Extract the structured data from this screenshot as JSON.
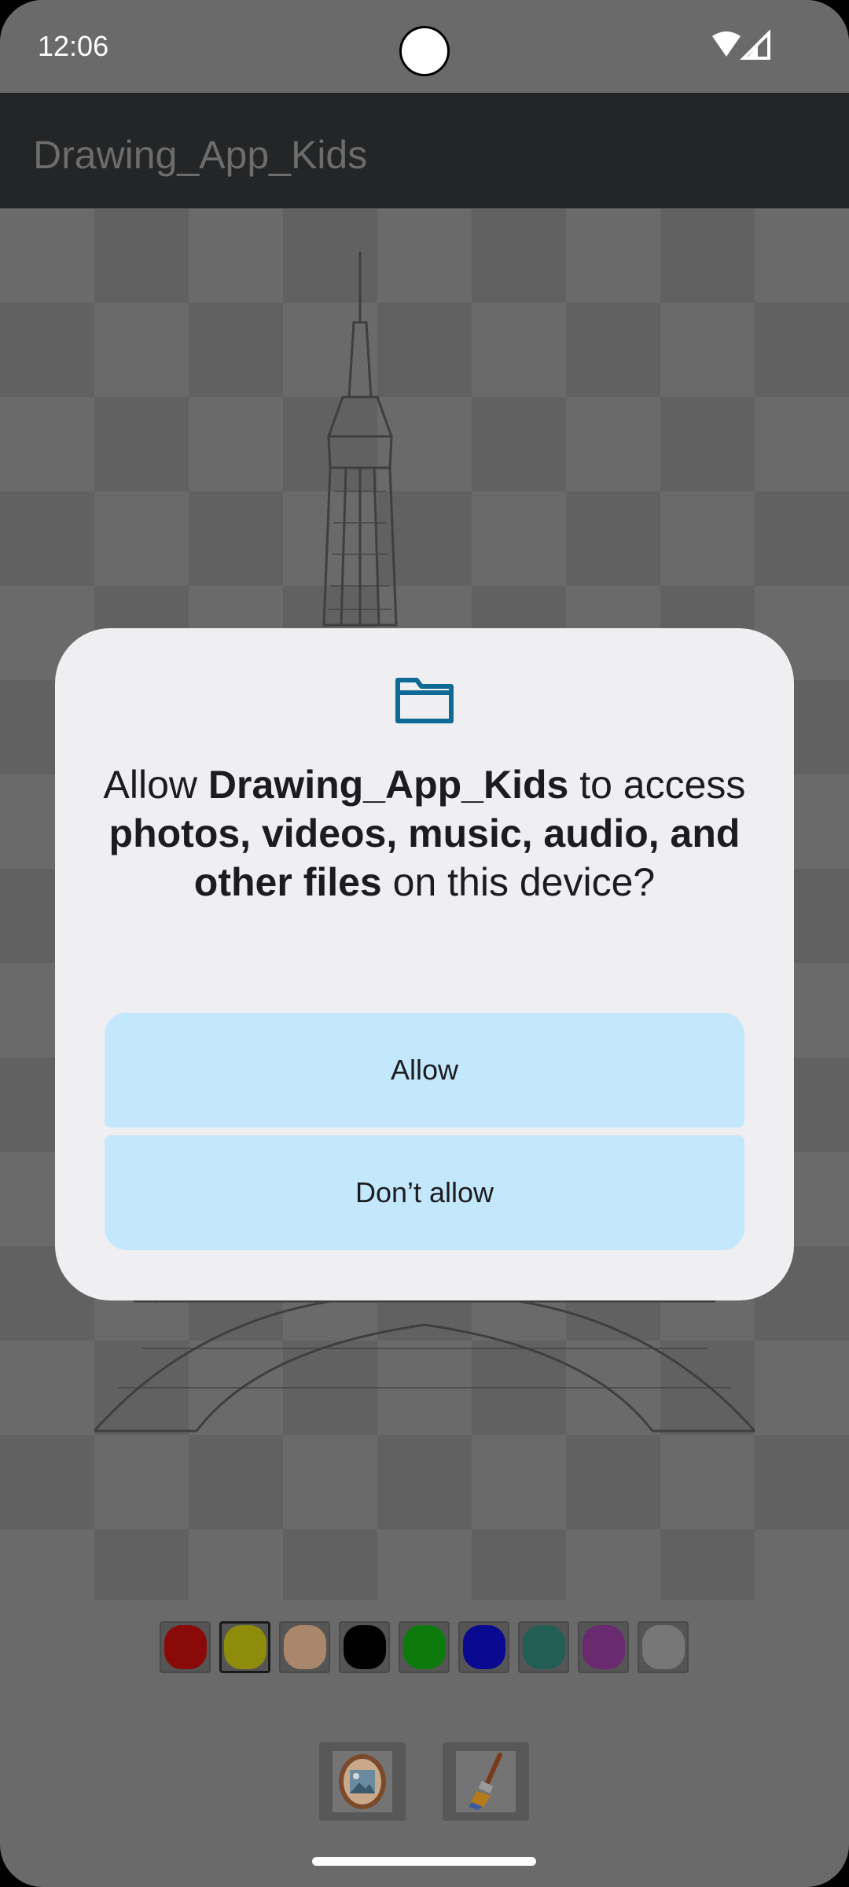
{
  "status_bar": {
    "time": "12:06",
    "icons": [
      "wifi-icon",
      "cell-signal-icon"
    ]
  },
  "app_bar": {
    "title": "Drawing_App_Kids"
  },
  "palette": {
    "colors": [
      "#8a0a0a",
      "#8e8c0a",
      "#a8876a",
      "#000000",
      "#0c7b0c",
      "#0a0a90",
      "#235e55",
      "#6a2a70",
      "#777777"
    ],
    "selected_index": 1
  },
  "toolbar": {
    "items": [
      "image-picker-icon",
      "brush-icon"
    ]
  },
  "dialog": {
    "icon": "folder-icon",
    "text_parts": {
      "p1": "Allow ",
      "app": "Drawing_App_Kids",
      "p2": " to access ",
      "what": "photos, videos, music, audio, and other files",
      "p3": " on this device?"
    },
    "allow_label": "Allow",
    "deny_label": "Don’t allow"
  }
}
